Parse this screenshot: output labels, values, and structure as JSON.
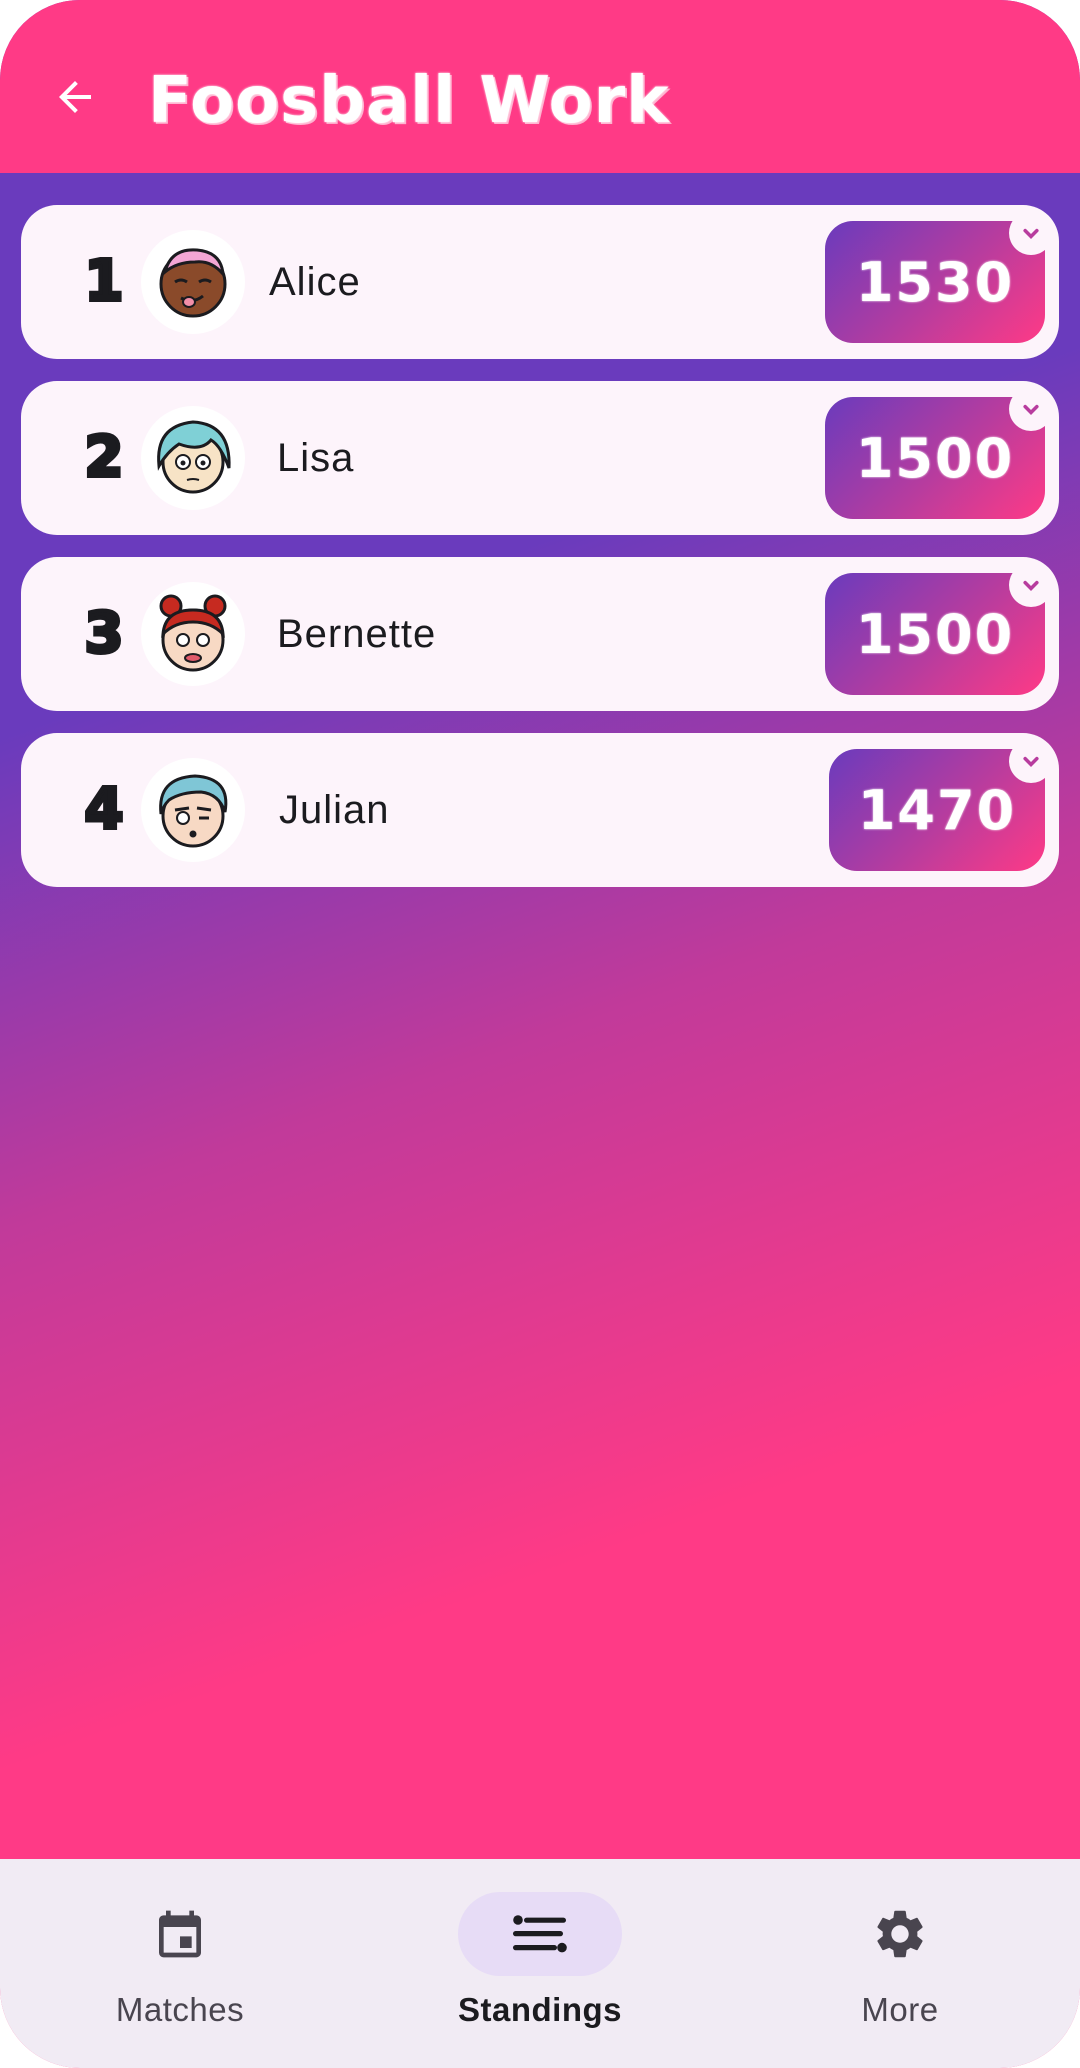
{
  "app_bar": {
    "title": "Foosball Work"
  },
  "standings": [
    {
      "rank": "1",
      "name": "Alice",
      "score": "1530",
      "avatar": "avatar-alice"
    },
    {
      "rank": "2",
      "name": "Lisa",
      "score": "1500",
      "avatar": "avatar-lisa"
    },
    {
      "rank": "3",
      "name": "Bernette",
      "score": "1500",
      "avatar": "avatar-bernette"
    },
    {
      "rank": "4",
      "name": "Julian",
      "score": "1470",
      "avatar": "avatar-julian"
    }
  ],
  "bottom_nav": {
    "items": [
      {
        "label": "Matches",
        "icon": "calendar-icon",
        "active": false
      },
      {
        "label": "Standings",
        "icon": "standings-icon",
        "active": true
      },
      {
        "label": "More",
        "icon": "gear-icon",
        "active": false
      }
    ]
  },
  "colors": {
    "appbar": "#ff3a86",
    "gradient_start": "#6a3bbd",
    "gradient_end": "#ff3a86",
    "card": "#fdf4fb",
    "nav_bg": "#f1ebf4",
    "nav_active_pill": "#e7dcf6"
  }
}
